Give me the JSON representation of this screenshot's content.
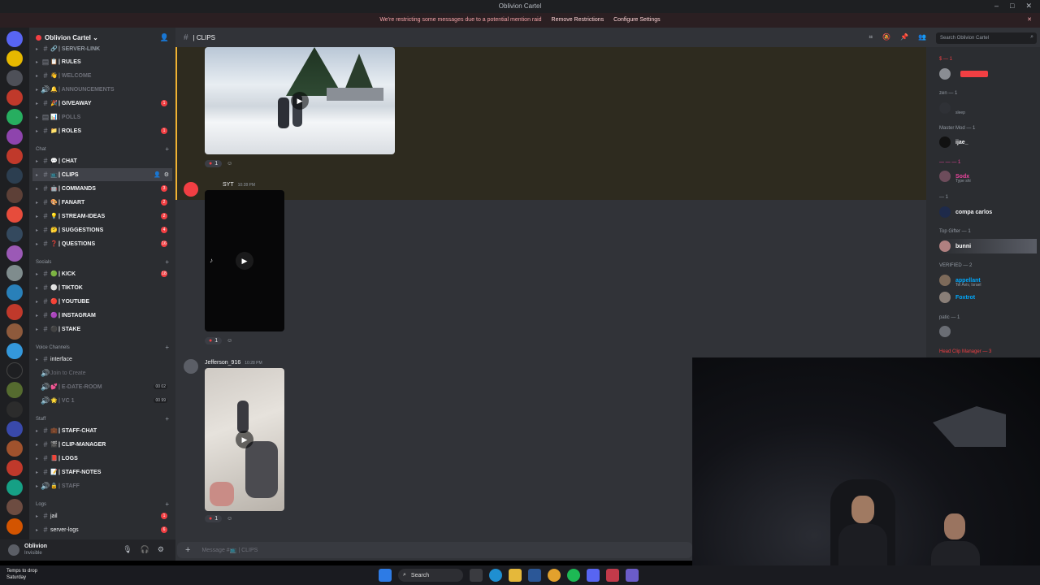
{
  "window": {
    "title": "Oblivion Cartel"
  },
  "notice": {
    "text": "We're restricting some messages due to a potential mention raid",
    "remove": "Remove Restrictions",
    "configure": "Configure Settings"
  },
  "server": {
    "name": "Oblivion Cartel ⌄"
  },
  "categories": {
    "chat": "Chat",
    "socials": "Socials",
    "voice": "Voice Channels",
    "staff": "Staff",
    "logs": "Logs"
  },
  "channels": {
    "server_link": "| SERVER-LINK",
    "rules": "| RULES",
    "welcome": "| WELCOME",
    "announcements": "| ANNOUNCEMENTS",
    "giveaway": "| GIVEAWAY",
    "polls": "| POLLS",
    "roles": "| ROLES",
    "chat": "| CHAT",
    "clips": "| CLIPS",
    "commands": "| COMMANDS",
    "fanart": "| FANART",
    "stream_ideas": "| STREAM-IDEAS",
    "suggestions": "| SUGGESTIONS",
    "questions": "| QUESTIONS",
    "kick": "| KICK",
    "tiktok": "| TIKTOK",
    "youtube": "| YOUTUBE",
    "instagram": "| INSTAGRAM",
    "stake": "| STAKE",
    "interface": "interface",
    "join_to_create": "Join to Create",
    "e_date_room": "| E-DATE-ROOM",
    "vc1": "| VC 1",
    "staff_chat": "| STAFF-CHAT",
    "clip_manager": "| CLIP-MANAGER",
    "logs": "| LOGS",
    "staff_notes": "| STAFF-NOTES",
    "staff": "| STAFF",
    "jail": "jail",
    "server_logs": "server-logs"
  },
  "badges": {
    "giveaway": "1",
    "roles": "1",
    "commands": "3",
    "fanart": "2",
    "stream_ideas": "2",
    "suggestions": "4",
    "questions": "16",
    "kick": "18",
    "jail": "1",
    "server_logs": "6"
  },
  "voice_counts": {
    "e_date": "00 02",
    "vc1": "00 99"
  },
  "user": {
    "name": "Oblivion",
    "status": "Invisible"
  },
  "header": {
    "channel": "| CLIPS"
  },
  "search": {
    "placeholder": "Search Oblivion Cartel"
  },
  "messages": [
    {
      "reaction_count": "1"
    },
    {
      "author": "SYT",
      "time": "10:28 PM",
      "reaction_count": "1"
    },
    {
      "author": "Jefferson_916",
      "time": "10:28 PM",
      "reaction_count": "1"
    }
  ],
  "composer": {
    "placeholder": "Message #📺 | CLIPS"
  },
  "members": {
    "groups": [
      {
        "label": "$ — 1"
      },
      {
        "label": "zen — 1"
      },
      {
        "label": "Master Mod — 1"
      },
      {
        "label": "— — — 1"
      },
      {
        "label": "— 1"
      },
      {
        "label": "Top Gifter — 1"
      },
      {
        "label": "VERIFIED — 2"
      },
      {
        "label": "patic — 1"
      },
      {
        "label": "Head Clip Manager — 3"
      }
    ],
    "list": [
      {
        "name": "",
        "status": ""
      },
      {
        "name": "",
        "status": "sleep"
      },
      {
        "name": "ijae_",
        "status": ""
      },
      {
        "name": "Sodx",
        "status": "Type shi"
      },
      {
        "name": "compa carlos",
        "status": ""
      },
      {
        "name": "bunni",
        "status": ""
      },
      {
        "name": "appellant",
        "status": "Tel Aviv, Israel"
      },
      {
        "name": "Foxtrot",
        "status": ""
      },
      {
        "name": "",
        "status": ""
      }
    ]
  },
  "taskbar": {
    "weather_line1": "Temps to drop",
    "weather_line2": "Saturday",
    "search": "Search"
  },
  "colors": {
    "accent": "#f23f43",
    "highlight": "#f0b232",
    "link": "#00a8fc",
    "pink": "#eb459e"
  }
}
